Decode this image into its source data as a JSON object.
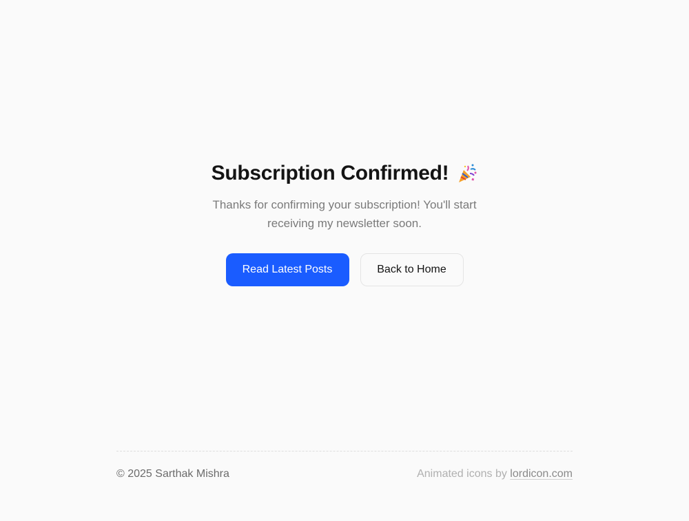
{
  "hero": {
    "title": "Subscription Confirmed!",
    "title_icon": "party-popper-icon",
    "subtitle": "Thanks for confirming your subscription! You'll start receiving my newsletter soon."
  },
  "actions": {
    "primary_label": "Read Latest Posts",
    "secondary_label": "Back to Home"
  },
  "footer": {
    "copyright": "© 2025 Sarthak Mishra",
    "credit_prefix": "Animated icons by ",
    "credit_link": "lordicon.com"
  },
  "colors": {
    "accent": "#1a5cff",
    "background": "#fafafa",
    "text": "#141414",
    "muted": "#7a7a7a"
  }
}
